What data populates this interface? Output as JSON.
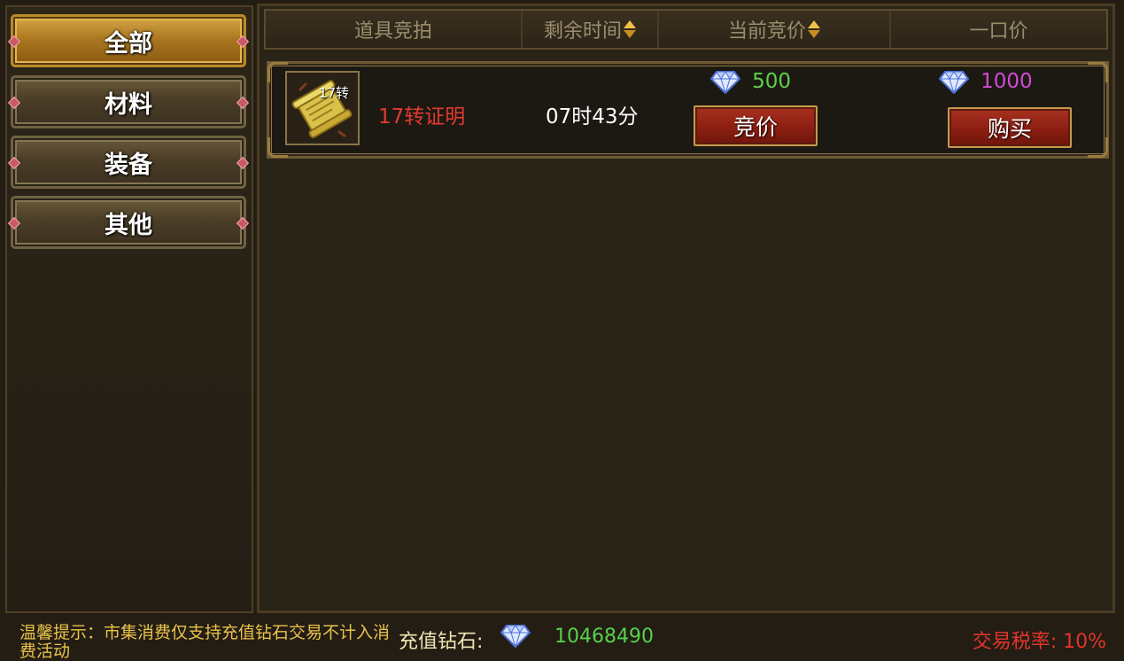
{
  "sidebar": {
    "categories": [
      {
        "label": "全部",
        "active": true
      },
      {
        "label": "材料",
        "active": false
      },
      {
        "label": "装备",
        "active": false
      },
      {
        "label": "其他",
        "active": false
      }
    ]
  },
  "table": {
    "headers": {
      "item": "道具竞拍",
      "time_left": "剩余时间",
      "current_bid": "当前竞价",
      "buyout": "一口价"
    },
    "rows": [
      {
        "item_name": "17转证明",
        "item_tag": "17转",
        "item_icon": "scroll-icon",
        "time_left": "07时43分",
        "current_bid": "500",
        "bid_button": "竞价",
        "buyout_price": "1000",
        "buy_button": "购买"
      }
    ]
  },
  "footer": {
    "tip": "温馨提示：市集消费仅支持充值钻石交易不计入消费活动",
    "balance_label": "充值钻石:",
    "balance_value": "10468490",
    "tax": "交易税率: 10%"
  },
  "colors": {
    "item_name": "#e23a2e",
    "bid_value": "#5fd04a",
    "buyout_value": "#d24ad6",
    "balance_value": "#58d04e",
    "tax": "#e2352b",
    "tip": "#e9c24b"
  }
}
